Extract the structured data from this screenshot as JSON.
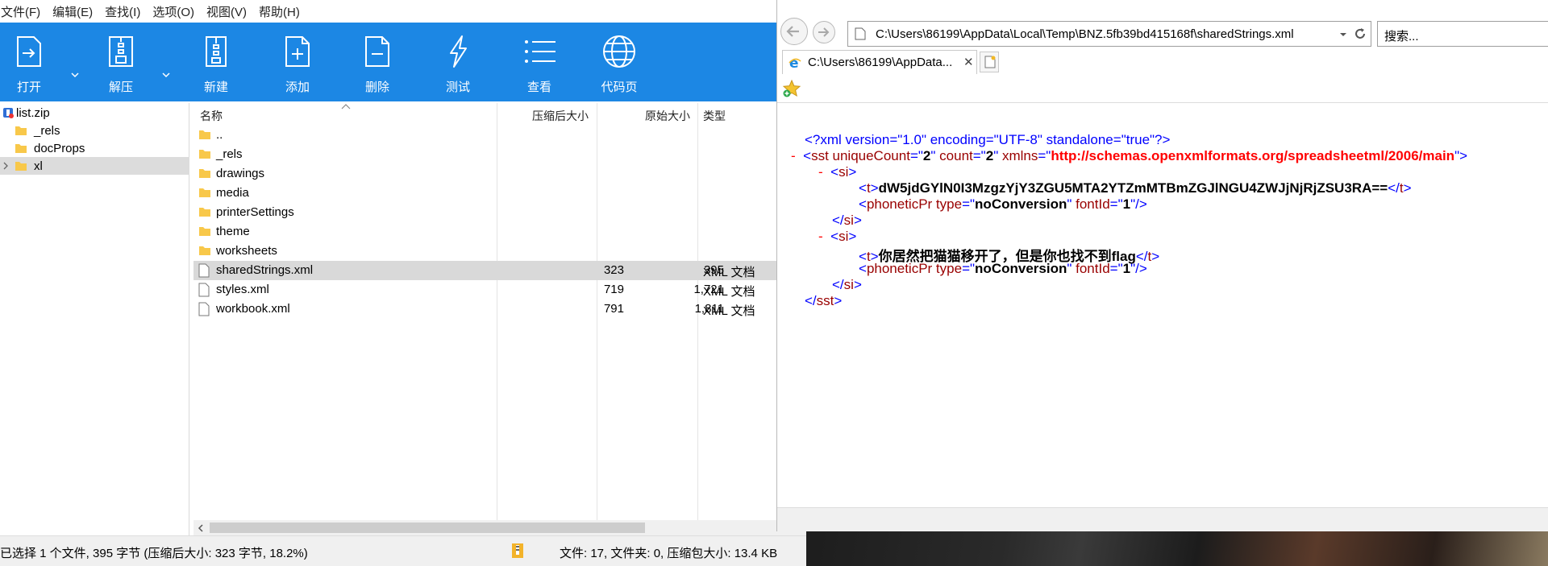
{
  "zip": {
    "menu": [
      "文件(F)",
      "编辑(E)",
      "查找(I)",
      "选项(O)",
      "视图(V)",
      "帮助(H)"
    ],
    "toolbar": {
      "open": "打开",
      "extract": "解压",
      "new": "新建",
      "add": "添加",
      "delete": "删除",
      "test": "测试",
      "view": "查看",
      "codepage": "代码页",
      "accent": "#1c87e4"
    },
    "tree": {
      "root": "list.zip",
      "items": [
        "_rels",
        "docProps",
        "xl"
      ]
    },
    "columns": {
      "name": "名称",
      "packed": "压缩后大小",
      "size": "原始大小",
      "type": "类型"
    },
    "files": [
      {
        "name": "..",
        "icon": "folder-icon",
        "packed": "",
        "size": "",
        "type": ""
      },
      {
        "name": "_rels",
        "icon": "folder-icon",
        "packed": "",
        "size": "",
        "type": ""
      },
      {
        "name": "drawings",
        "icon": "folder-icon",
        "packed": "",
        "size": "",
        "type": ""
      },
      {
        "name": "media",
        "icon": "folder-icon",
        "packed": "",
        "size": "",
        "type": ""
      },
      {
        "name": "printerSettings",
        "icon": "folder-icon",
        "packed": "",
        "size": "",
        "type": ""
      },
      {
        "name": "theme",
        "icon": "folder-icon",
        "packed": "",
        "size": "",
        "type": ""
      },
      {
        "name": "worksheets",
        "icon": "folder-icon",
        "packed": "",
        "size": "",
        "type": ""
      },
      {
        "name": "sharedStrings.xml",
        "icon": "file-icon",
        "packed": "323",
        "size": "395",
        "type": "XML 文档"
      },
      {
        "name": "styles.xml",
        "icon": "file-icon",
        "packed": "719",
        "size": "1,721",
        "type": "XML 文档"
      },
      {
        "name": "workbook.xml",
        "icon": "file-icon",
        "packed": "791",
        "size": "1,811",
        "type": "XML 文档"
      }
    ],
    "status_left": "已选择 1 个文件, 395 字节 (压缩后大小: 323 字节, 18.2%)",
    "status_right": "文件: 17, 文件夹: 0, 压缩包大小: 13.4 KB"
  },
  "ie": {
    "address": "C:\\Users\\86199\\AppData\\Local\\Temp\\BNZ.5fb39bd415168f\\sharedStrings.xml",
    "search_placeholder": "搜索...",
    "tab_title": "C:\\Users\\86199\\AppData...",
    "xml": {
      "decl": "<?xml version=\"1.0\" encoding=\"UTF-8\" standalone=\"true\"?>",
      "sst_unique_count": "2",
      "sst_count": "2",
      "sst_xmlns": "http://schemas.openxmlformats.org/spreadsheetml/2006/main",
      "si1_t": "dW5jdGYlN0I3MzgzYjY3ZGU5MTA2YTZmMTBmZGJlNGU4ZWJjNjRjZSU3RA==",
      "si2_t": "你居然把猫猫移开了，但是你也找不到flag",
      "phonetic_type": "noConversion",
      "phonetic_font": "1"
    }
  }
}
